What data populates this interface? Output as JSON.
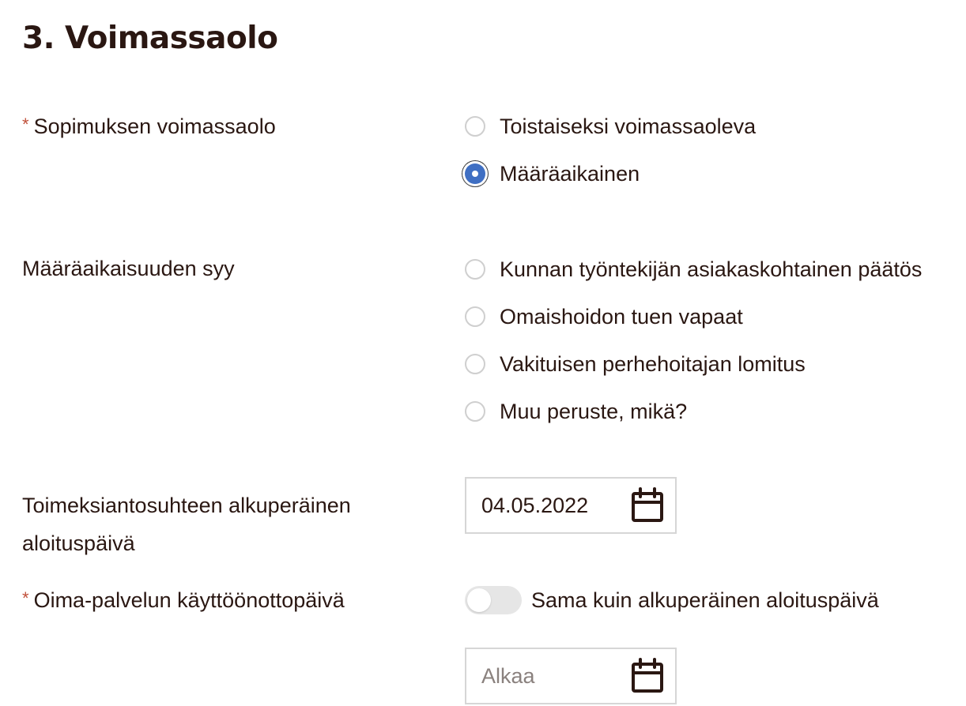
{
  "section": {
    "title": "3. Voimassaolo"
  },
  "validity": {
    "label": "Sopimuksen voimassaolo",
    "required": true,
    "options": [
      {
        "label": "Toistaiseksi voimassaoleva",
        "selected": false
      },
      {
        "label": "Määräaikainen",
        "selected": true
      }
    ]
  },
  "reason": {
    "label": "Määräaikaisuuden syy",
    "options": [
      {
        "label": "Kunnan työntekijän asiakaskohtainen päätös",
        "selected": false
      },
      {
        "label": "Omaishoidon tuen vapaat",
        "selected": false
      },
      {
        "label": "Vakituisen perhehoitajan lomitus",
        "selected": false
      },
      {
        "label": "Muu peruste, mikä?",
        "selected": false
      }
    ]
  },
  "original_start": {
    "label": "Toimeksiantosuhteen alkuperäinen aloituspäivä",
    "value": "04.05.2022",
    "icon": "calendar-icon"
  },
  "oima_start": {
    "label": "Oima-palvelun käyttöönottopäivä",
    "required": true,
    "toggle_label": "Sama kuin alkuperäinen aloituspäivä",
    "toggle_on": false,
    "placeholder": "Alkaa",
    "icon": "calendar-icon"
  },
  "colors": {
    "text": "#2a1712",
    "required": "#c0503a",
    "radio_selected": "#3f6fc3",
    "border": "#d6d6d6"
  }
}
